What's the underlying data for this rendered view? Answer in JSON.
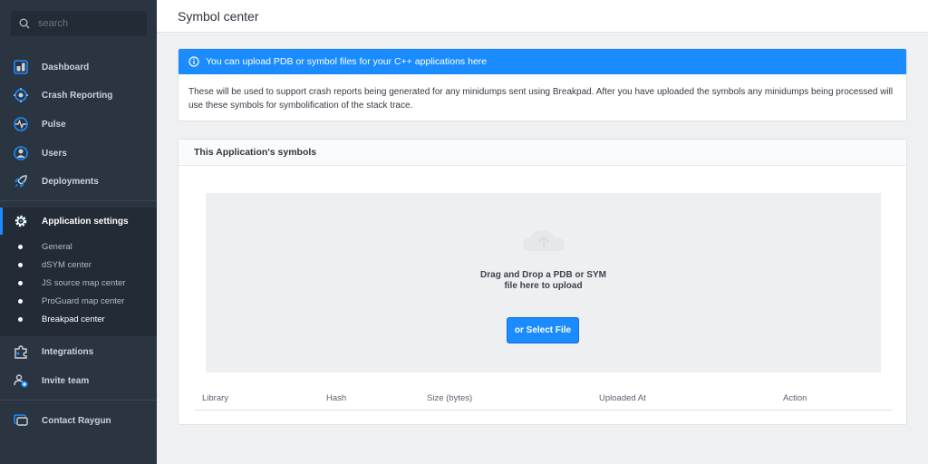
{
  "search": {
    "placeholder": "search"
  },
  "nav": {
    "dashboard": "Dashboard",
    "crash_reporting": "Crash Reporting",
    "pulse": "Pulse",
    "users": "Users",
    "deployments": "Deployments",
    "application_settings": "Application settings",
    "integrations": "Integrations",
    "invite_team": "Invite team",
    "contact": "Contact Raygun"
  },
  "subnav": [
    "General",
    "dSYM center",
    "JS source map center",
    "ProGuard map center",
    "Breakpad center"
  ],
  "page": {
    "title": "Symbol center"
  },
  "info": {
    "header": "You can upload PDB or symbol files for your C++ applications here",
    "body": "These will be used to support crash reports being generated for any minidumps sent using Breakpad. After you have uploaded the symbols any minidumps being processed will use these symbols for symbolification of the stack trace."
  },
  "symbols": {
    "header": "This Application's symbols",
    "drop_line1": "Drag and Drop a PDB or SYM",
    "drop_line2": "file here to upload",
    "select_button": "or Select File",
    "columns": [
      "Library",
      "Hash",
      "Size (bytes)",
      "Uploaded At",
      "Action"
    ]
  },
  "colors": {
    "accent": "#1a8cff",
    "sidebar": "#2b3542",
    "sidebar_dark": "#222b36"
  }
}
